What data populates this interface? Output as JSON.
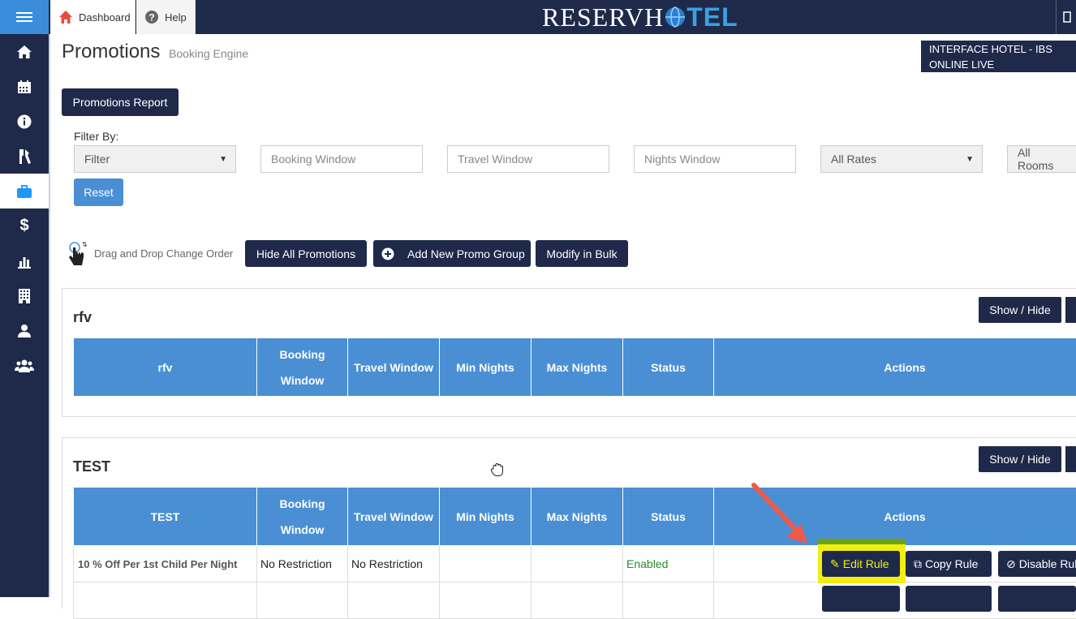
{
  "topbar": {
    "tabs": [
      {
        "label": "Dashboard",
        "icon": "home-icon"
      },
      {
        "label": "Help",
        "icon": "help-icon"
      }
    ],
    "logo_part1": "RESERVH",
    "logo_part2": "TEL"
  },
  "sidebar": {
    "items": [
      "home-icon",
      "calendar-icon",
      "info-icon",
      "tools-icon",
      "briefcase-icon",
      "dollar-icon",
      "bar-chart-icon",
      "building-icon",
      "user-icon",
      "users-icon"
    ],
    "active_index": 4
  },
  "page": {
    "title": "Promotions",
    "subtitle": "Booking Engine",
    "hotel_name": "INTERFACE HOTEL - IBS ONLINE LIVE",
    "report_button": "Promotions Report"
  },
  "filter": {
    "label": "Filter By:",
    "filter_select": "Filter",
    "booking_window_placeholder": "Booking Window",
    "travel_window_placeholder": "Travel Window",
    "nights_window_placeholder": "Nights Window",
    "rates_select": "All Rates",
    "rooms_select": "All Rooms",
    "reset_button": "Reset"
  },
  "toolbar": {
    "dnd_label": "Drag and Drop Change Order",
    "hide_all": "Hide All Promotions",
    "add_group": "Add New Promo Group",
    "modify_bulk": "Modify in Bulk"
  },
  "groups": [
    {
      "title": "rfv",
      "show_hide": "Show / Hide",
      "columns": [
        "rfv",
        "Booking Window",
        "Travel Window",
        "Min Nights",
        "Max Nights",
        "Status",
        "Actions"
      ],
      "rows": []
    },
    {
      "title": "TEST",
      "show_hide": "Show / Hide",
      "columns": [
        "TEST",
        "Booking Window",
        "Travel Window",
        "Min Nights",
        "Max Nights",
        "Status",
        "Actions"
      ],
      "rows": [
        {
          "name": "10 % Off Per 1st Child Per Night",
          "booking": "No Restriction",
          "travel": "No Restriction",
          "min": "",
          "max": "",
          "status": "Enabled",
          "actions": {
            "edit": "Edit Rule",
            "copy": "Copy Rule",
            "disable": "Disable Rule"
          }
        }
      ]
    }
  ],
  "colors": {
    "navy": "#1f2a4a",
    "blue": "#4a8fd4",
    "highlight": "#f2ee10",
    "arrow": "#ef5a48",
    "enabled": "#2a8a2a"
  }
}
